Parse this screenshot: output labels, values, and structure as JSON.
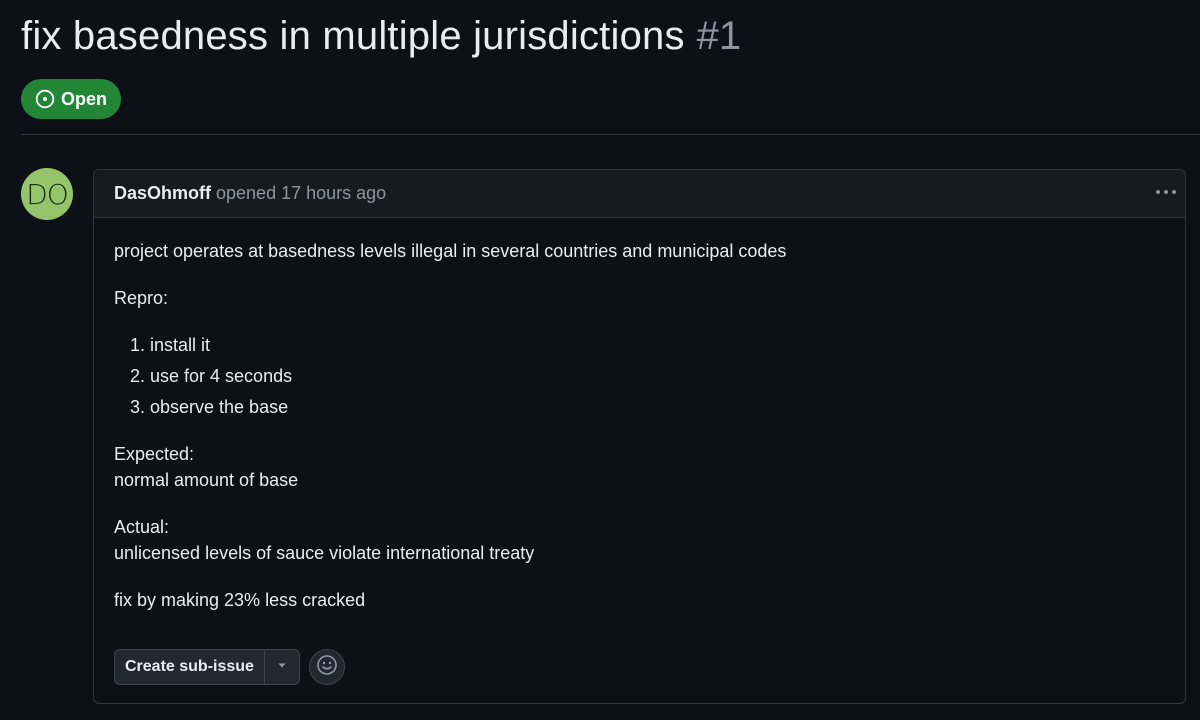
{
  "issue": {
    "title": "fix basedness in multiple jurisdictions",
    "number": "#1",
    "state_label": "Open",
    "state_color": "#238636"
  },
  "comment": {
    "avatar_initials": "DO",
    "avatar_color": "#96c46c",
    "author": "DasOhmoff",
    "meta": "opened 17 hours ago",
    "body": {
      "intro": "project operates at basedness levels illegal in several countries and municipal codes",
      "repro_label": "Repro:",
      "steps": [
        "install it",
        "use for 4 seconds",
        "observe the base"
      ],
      "expected_label": "Expected:",
      "expected_text": "normal amount of base",
      "actual_label": "Actual:",
      "actual_text": "unlicensed levels of sauce violate international treaty",
      "fix_text": "fix by making 23% less cracked"
    }
  },
  "actions": {
    "create_sub_issue_label": "Create sub-issue",
    "caret_icon": "triangle-down-icon",
    "reaction_icon": "smiley-icon"
  },
  "icons": {
    "state_icon": "issue-opened-icon",
    "menu_icon": "kebab-horizontal-icon"
  }
}
